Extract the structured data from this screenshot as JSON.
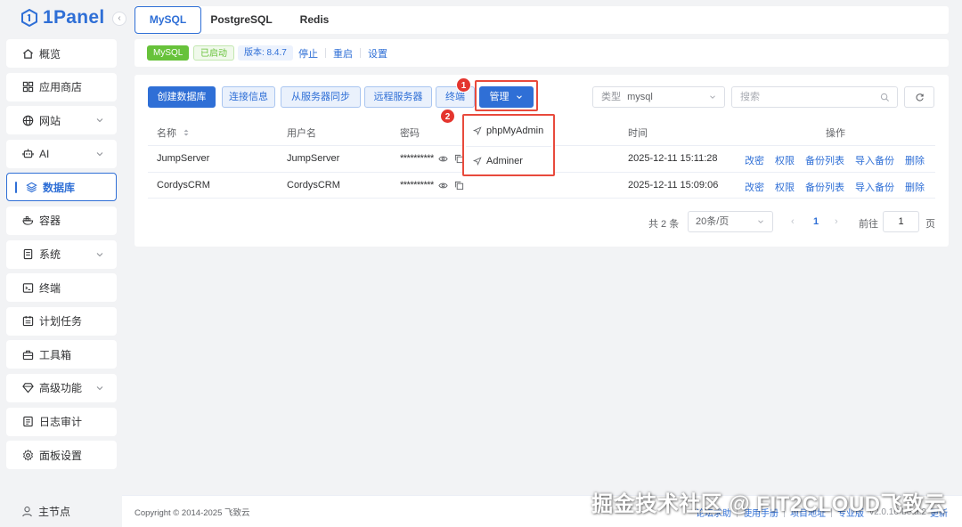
{
  "sidebar": {
    "logo_text": "1Panel",
    "items": [
      {
        "label": "概览",
        "icon": "home-icon"
      },
      {
        "label": "应用商店",
        "icon": "grid-icon"
      },
      {
        "label": "网站",
        "icon": "globe-icon",
        "expandable": true
      },
      {
        "label": "AI",
        "icon": "robot-icon",
        "expandable": true
      },
      {
        "label": "数据库",
        "icon": "layers-icon",
        "active": true
      },
      {
        "label": "容器",
        "icon": "docker-icon"
      },
      {
        "label": "系统",
        "icon": "server-icon",
        "expandable": true
      },
      {
        "label": "终端",
        "icon": "terminal-icon"
      },
      {
        "label": "计划任务",
        "icon": "calendar-icon"
      },
      {
        "label": "工具箱",
        "icon": "toolbox-icon"
      },
      {
        "label": "高级功能",
        "icon": "diamond-icon",
        "expandable": true
      },
      {
        "label": "日志审计",
        "icon": "log-icon"
      },
      {
        "label": "面板设置",
        "icon": "settings-icon"
      }
    ],
    "node_label": "主节点"
  },
  "tabs": [
    "MySQL",
    "PostgreSQL",
    "Redis"
  ],
  "status": {
    "name_badge": "MySQL",
    "state_badge": "已启动",
    "version_badge": "版本: 8.4.7",
    "actions": [
      "停止",
      "重启",
      "设置"
    ]
  },
  "toolbar": {
    "create": "创建数据库",
    "conn_info": "连接信息",
    "sync": "从服务器同步",
    "remote": "远程服务器",
    "terminal": "终端",
    "manage": "管理",
    "type_label": "类型",
    "type_value": "mysql",
    "search_placeholder": "搜索"
  },
  "table": {
    "headers": {
      "name": "名称",
      "user": "用户名",
      "password": "密码",
      "time": "时间",
      "ops": "操作"
    },
    "rows": [
      {
        "name": "JumpServer",
        "user": "JumpServer",
        "password": "**********",
        "time": "2025-12-11 15:11:28"
      },
      {
        "name": "CordysCRM",
        "user": "CordysCRM",
        "password": "**********",
        "time": "2025-12-11 15:09:06"
      }
    ],
    "row_ops": [
      "改密",
      "权限",
      "备份列表",
      "导入备份",
      "删除"
    ]
  },
  "pagination": {
    "total": "共 2 条",
    "page_size": "20条/页",
    "current": "1",
    "goto_label": "前往",
    "goto_value": "1",
    "page_unit": "页"
  },
  "manage_menu": {
    "items": [
      "phpMyAdmin",
      "Adminer"
    ]
  },
  "markers": [
    "1",
    "2"
  ],
  "footer": {
    "copyright": "Copyright © 2014-2025 飞致云",
    "links": [
      "论坛求助",
      "使用手册",
      "项目地址",
      "专业版"
    ],
    "version": "v2.0.16-beta.2",
    "update": "更新"
  },
  "watermark": "掘金技术社区 @ FIT2CLOUD飞致云",
  "colors": {
    "accent": "#2f6fd6",
    "success": "#67c23a",
    "marker": "#e4352e"
  }
}
